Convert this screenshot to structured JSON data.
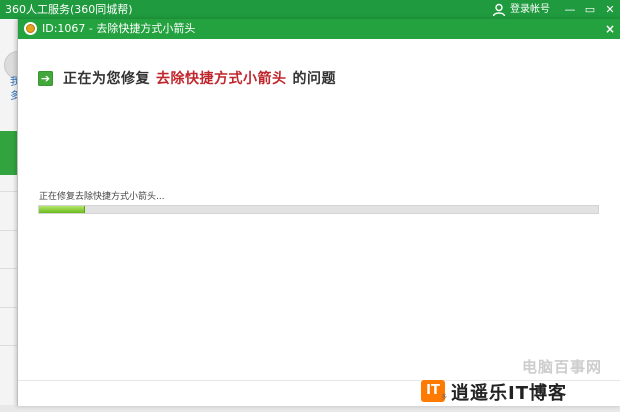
{
  "outer_window": {
    "title": "360人工服务(360同城帮)",
    "login_label": "登录帐号",
    "minimize": "—",
    "chat": "▭",
    "close": "✕",
    "left_links": [
      "我",
      "多"
    ]
  },
  "dialog": {
    "title": "ID:1067 - 去除快捷方式小箭头",
    "close": "×",
    "heading_prefix": "正在为您修复",
    "heading_highlight": "去除快捷方式小箭头",
    "heading_suffix": "的问题",
    "status_text": "正在修复去除快捷方式小箭头...",
    "progress_percent": 8
  },
  "watermark": {
    "line1": "电脑百事网",
    "badge": "IT",
    "line2": "逍遥乐IT博客",
    "small": "多"
  },
  "colors": {
    "title_green": "#23a23f",
    "accent_red": "#c0272d",
    "progress_green": "#6bbb1f"
  }
}
